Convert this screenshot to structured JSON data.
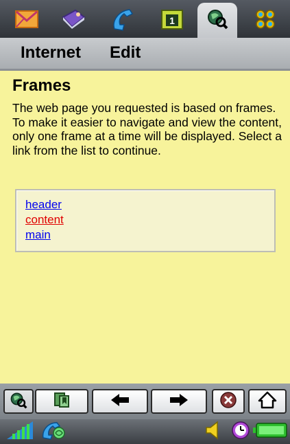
{
  "menu": {
    "internet": "Internet",
    "edit": "Edit"
  },
  "page": {
    "title": "Frames",
    "description": "The web page you requested is based on frames. To make it easier to navigate and view the content, only one frame at a time will be displayed. Select a link from the list to continue."
  },
  "frame_links": [
    {
      "label": "header",
      "color": "#0000ee"
    },
    {
      "label": "content",
      "color": "#e00000"
    },
    {
      "label": "main",
      "color": "#0000ee"
    }
  ],
  "tabs": [
    "messaging-icon",
    "contacts-icon",
    "phone-icon",
    "calendar-icon",
    "internet-icon",
    "applications-icon"
  ],
  "toolbar": [
    "internet-icon",
    "bookmark-icon",
    "back-arrow-icon",
    "forward-arrow-icon",
    "stop-icon",
    "home-icon"
  ],
  "status": [
    "signal-strength-icon",
    "gprs-connection-icon",
    "volume-icon",
    "clock-icon",
    "battery-icon"
  ],
  "colors": {
    "content_bg": "#f7f39b",
    "linkbox_bg": "#f5f3cf",
    "link": "#0000ee",
    "link_active": "#e00000"
  }
}
